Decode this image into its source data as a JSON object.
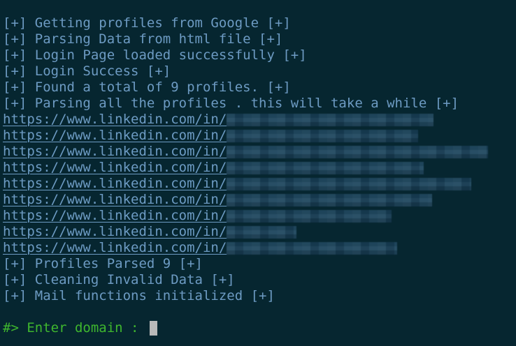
{
  "log_lines": [
    "[+] Getting profiles from Google [+]",
    "[+] Parsing Data from html file [+]",
    "[+] Login Page loaded successfully [+]",
    "[+] Login Success [+]",
    "[+] Found a total of 9 profiles. [+]",
    "[+] Parsing all the profiles . this will take a while [+]"
  ],
  "url_prefix": "https://www.linkedin.com/in/",
  "status_lines": [
    "[+] Profiles Parsed 9 [+]",
    "[+] Cleaning Invalid Data [+]",
    "[+] Mail functions initialized [+]"
  ],
  "prompt": {
    "text": "#> Enter domain : ",
    "input_value": ""
  },
  "colors": {
    "background": "#062630",
    "text": "#6d9bc3",
    "prompt": "#3fb72e",
    "cursor": "#b9b9b9"
  }
}
